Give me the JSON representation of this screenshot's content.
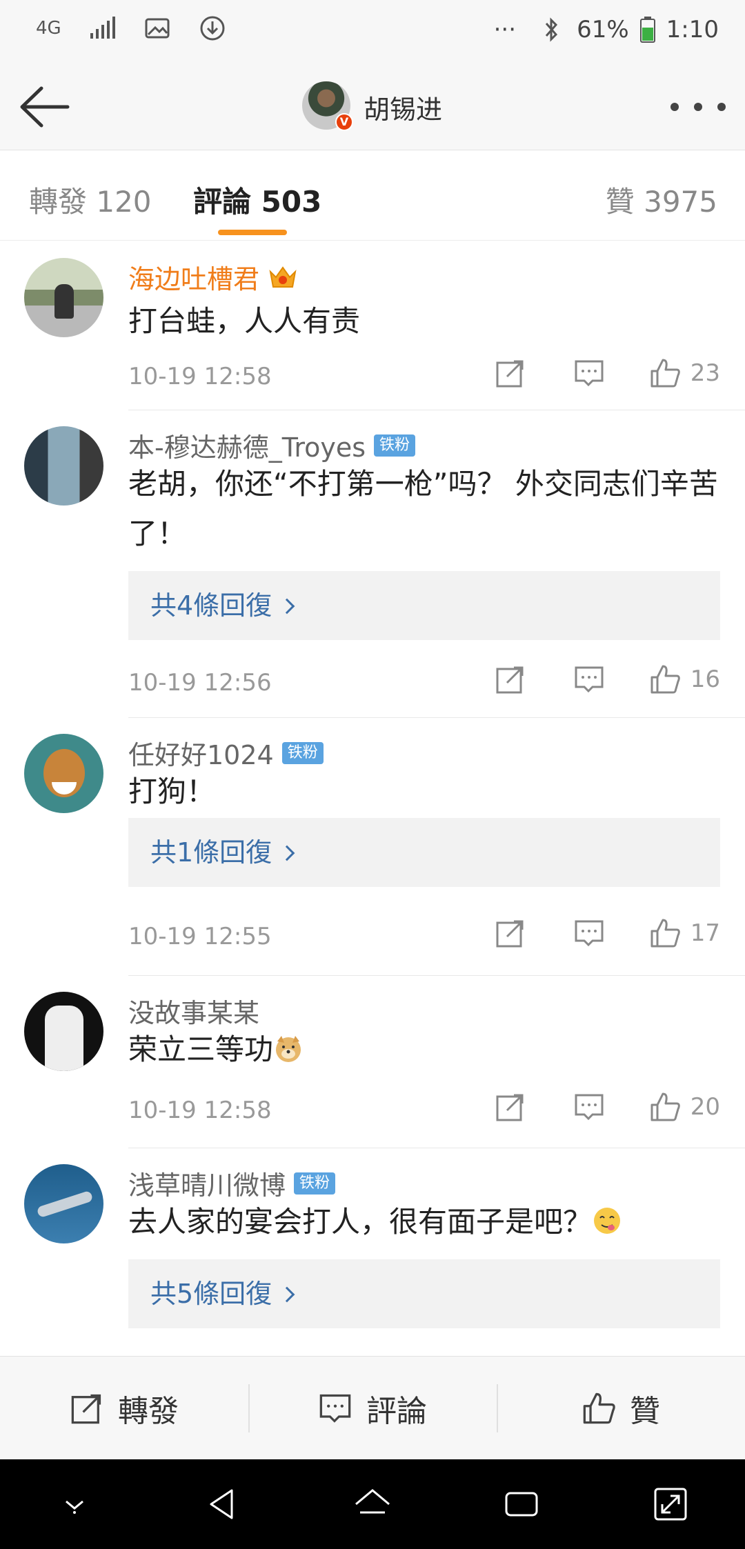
{
  "status_bar": {
    "network": "4G",
    "battery": "61%",
    "time": "1:10",
    "dots": "···"
  },
  "header": {
    "title": "胡锡进",
    "verified_badge": "V"
  },
  "tabs": [
    {
      "label": "轉發 120"
    },
    {
      "label": "評論 503"
    },
    {
      "label": "贊 3975"
    }
  ],
  "comments": [
    {
      "user": "海边吐槽君",
      "text": "打台蛙，人人有责",
      "time": "10-19 12:58",
      "likes": "23",
      "reply": null
    },
    {
      "user": "本-穆达赫德_Troyes",
      "badge": "铁粉",
      "text": "老胡，你还“不打第一枪”吗？ 外交同志们辛苦了！",
      "reply": "共4條回復",
      "time": "10-19 12:56",
      "likes": "16"
    },
    {
      "user": "任好好1024",
      "badge": "铁粉",
      "text": "打狗！",
      "reply": "共1條回復",
      "time": "10-19 12:55",
      "likes": "17"
    },
    {
      "user": "没故事某某",
      "text": "荣立三等功",
      "time": "10-19 12:58",
      "likes": "20"
    },
    {
      "user": "浅草晴川微博",
      "badge": "铁粉",
      "text": "去人家的宴会打人，很有面子是吧？",
      "reply": "共5條回復"
    }
  ],
  "bottom_bar": {
    "repost": "轉發",
    "comment": "評論",
    "like": "贊"
  },
  "colors": {
    "accent_orange": "#f7921e",
    "link_blue": "#3b6ea8",
    "fan_badge_blue": "#5aa3e0"
  }
}
